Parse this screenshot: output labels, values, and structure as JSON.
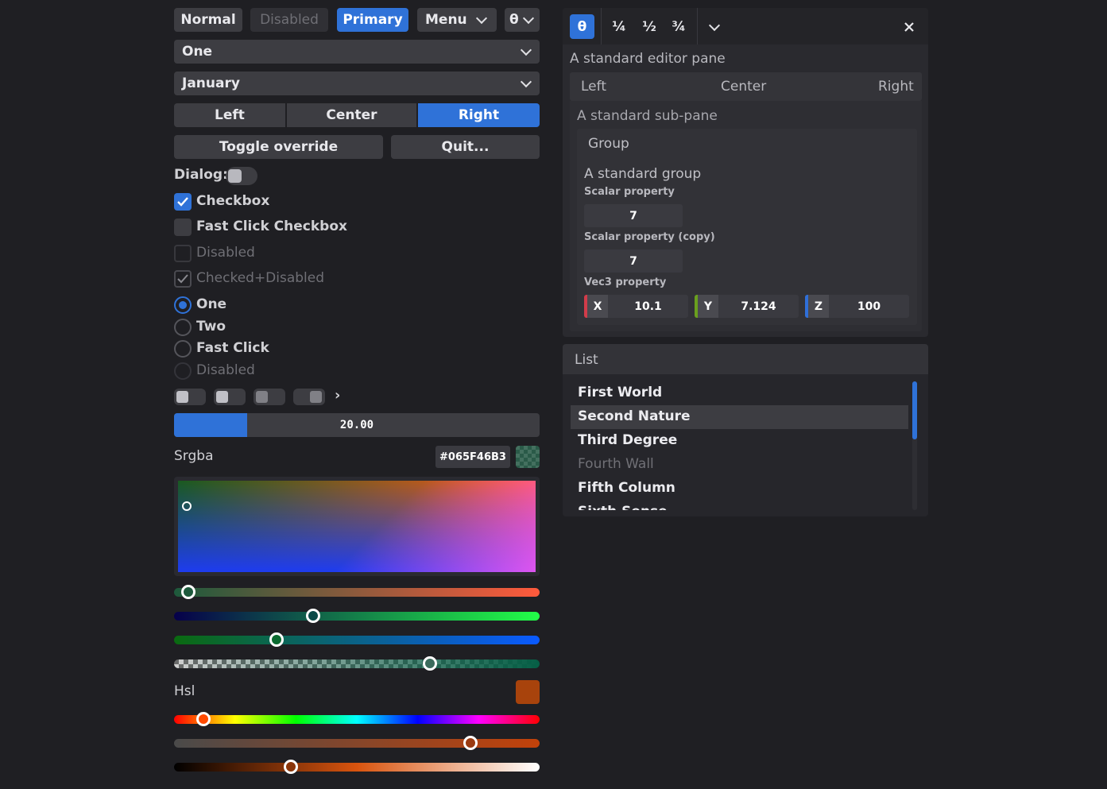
{
  "toolbar": {
    "normal": "Normal",
    "disabled": "Disabled",
    "primary": "Primary",
    "menu": "Menu",
    "theme": "θ"
  },
  "combos": {
    "first": "One",
    "second": "January"
  },
  "segmented": {
    "left": "Left",
    "center": "Center",
    "right": "Right"
  },
  "buttons": {
    "toggle_override": "Toggle override",
    "quit": "Quit..."
  },
  "dialog_label": "Dialog:",
  "checkboxes": [
    {
      "label": "Checkbox",
      "checked": true
    },
    {
      "label": "Fast Click Checkbox",
      "checked": false
    },
    {
      "label": "Disabled",
      "checked": false
    },
    {
      "label": "Checked+Disabled",
      "checked": true
    }
  ],
  "radios": [
    {
      "label": "One",
      "selected": true
    },
    {
      "label": "Two",
      "selected": false
    },
    {
      "label": "Fast Click",
      "selected": false
    },
    {
      "label": "Disabled",
      "selected": false
    }
  ],
  "toggles_more": "›",
  "progress": {
    "value_text": "20.00",
    "fraction": 0.2
  },
  "srgba": {
    "label": "Srgba",
    "hex": "#065F46B3",
    "sliders": [
      0.04,
      0.38,
      0.28,
      0.7
    ]
  },
  "hsl": {
    "label": "Hsl",
    "swatch_color": "#a8430c",
    "sliders": [
      0.08,
      0.81,
      0.32
    ]
  },
  "editor": {
    "tabs": [
      "θ",
      "¼",
      "½",
      "¾"
    ],
    "title": "A standard editor pane",
    "header": {
      "left": "Left",
      "center": "Center",
      "right": "Right"
    },
    "subpane_title": "A standard sub-pane",
    "group_label": "Group",
    "group_title": "A standard group",
    "scalar_label": "Scalar property",
    "scalar_value": "7",
    "scalar_copy_label": "Scalar property (copy)",
    "scalar_copy_value": "7",
    "vec3_label": "Vec3 property",
    "vec3": [
      {
        "axis": "X",
        "value": "10.1",
        "color": "#d23c4a"
      },
      {
        "axis": "Y",
        "value": "7.124",
        "color": "#6aa01e"
      },
      {
        "axis": "Z",
        "value": "100",
        "color": "#2f6fd8"
      }
    ]
  },
  "list": {
    "title": "List",
    "items": [
      "First World",
      "Second Nature",
      "Third Degree",
      "Fourth Wall",
      "Fifth Column",
      "Sixth Sense"
    ]
  }
}
